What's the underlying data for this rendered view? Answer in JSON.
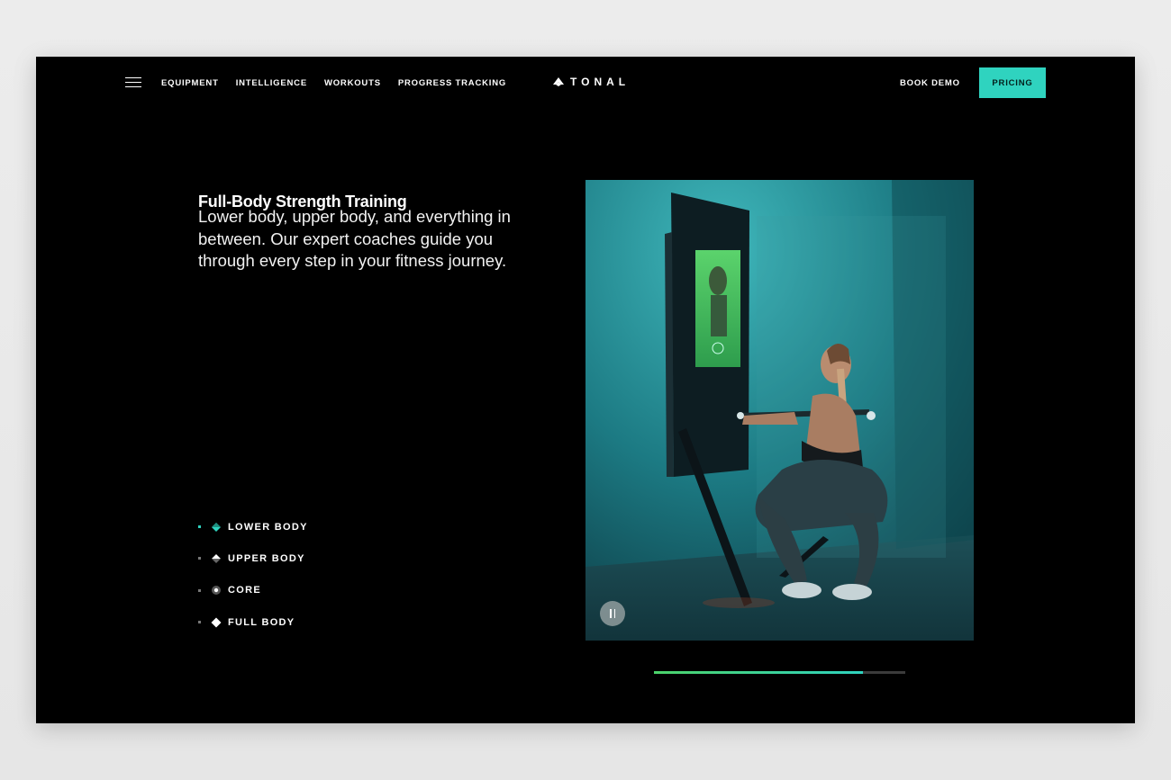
{
  "nav": {
    "links": [
      "EQUIPMENT",
      "INTELLIGENCE",
      "WORKOUTS",
      "PROGRESS TRACKING"
    ],
    "logo_text": "TONAL",
    "book_demo": "BOOK DEMO",
    "pricing": "PRICING"
  },
  "content": {
    "heading": "Full-Body Strength Training",
    "description": "Lower body, upper body, and everything in between. Our expert coaches guide you through every step in your fitness journey."
  },
  "categories": [
    {
      "label": "LOWER BODY",
      "icon": "lower-body-icon",
      "active": true
    },
    {
      "label": "UPPER BODY",
      "icon": "upper-body-icon",
      "active": false
    },
    {
      "label": "CORE",
      "icon": "core-icon",
      "active": false
    },
    {
      "label": "FULL BODY",
      "icon": "full-body-icon",
      "active": false
    }
  ],
  "media": {
    "progress": 0.83,
    "pause_icon": "pause-icon"
  },
  "colors": {
    "accent": "#2fd3bf",
    "background": "#000000",
    "progress_green": "#4cd36a"
  }
}
